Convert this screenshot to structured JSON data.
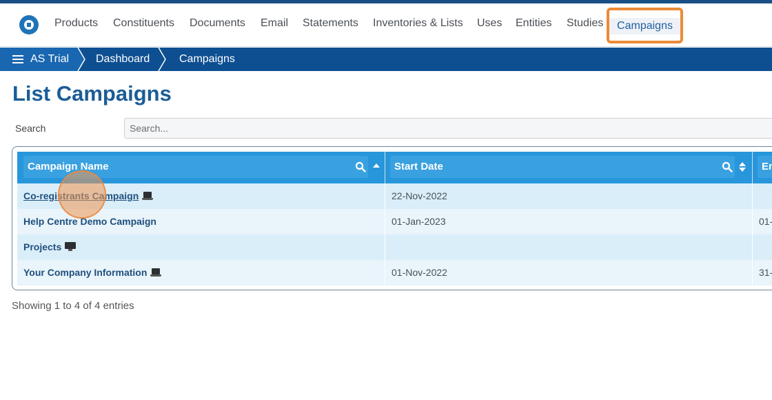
{
  "nav": {
    "items": [
      "Products",
      "Constituents",
      "Documents",
      "Email",
      "Statements",
      "Inventories & Lists",
      "Uses",
      "Entities",
      "Studies"
    ],
    "active": "Campaigns"
  },
  "breadcrumb": {
    "root": "AS Trial",
    "items": [
      "Dashboard",
      "Campaigns"
    ]
  },
  "page": {
    "title": "List Campaigns",
    "search_label": "Search",
    "search_placeholder": "Search..."
  },
  "table": {
    "headers": {
      "name": "Campaign Name",
      "start": "Start Date",
      "end": "En"
    },
    "rows": [
      {
        "name": "Co-registrants Campaign",
        "icon": "laptop-icon",
        "start": "22-Nov-2022",
        "end": ""
      },
      {
        "name": "Help Centre Demo Campaign",
        "icon": "",
        "start": "01-Jan-2023",
        "end": "01-"
      },
      {
        "name": "Projects",
        "icon": "monitor-icon",
        "start": "",
        "end": ""
      },
      {
        "name": "Your Company Information",
        "icon": "laptop-icon",
        "start": "01-Nov-2022",
        "end": "31-"
      }
    ]
  },
  "footer": {
    "entries_info": "Showing 1 to 4 of 4 entries"
  },
  "colors": {
    "brand_dark": "#0e4f92",
    "brand": "#2796db",
    "highlight": "#ec8a36"
  }
}
